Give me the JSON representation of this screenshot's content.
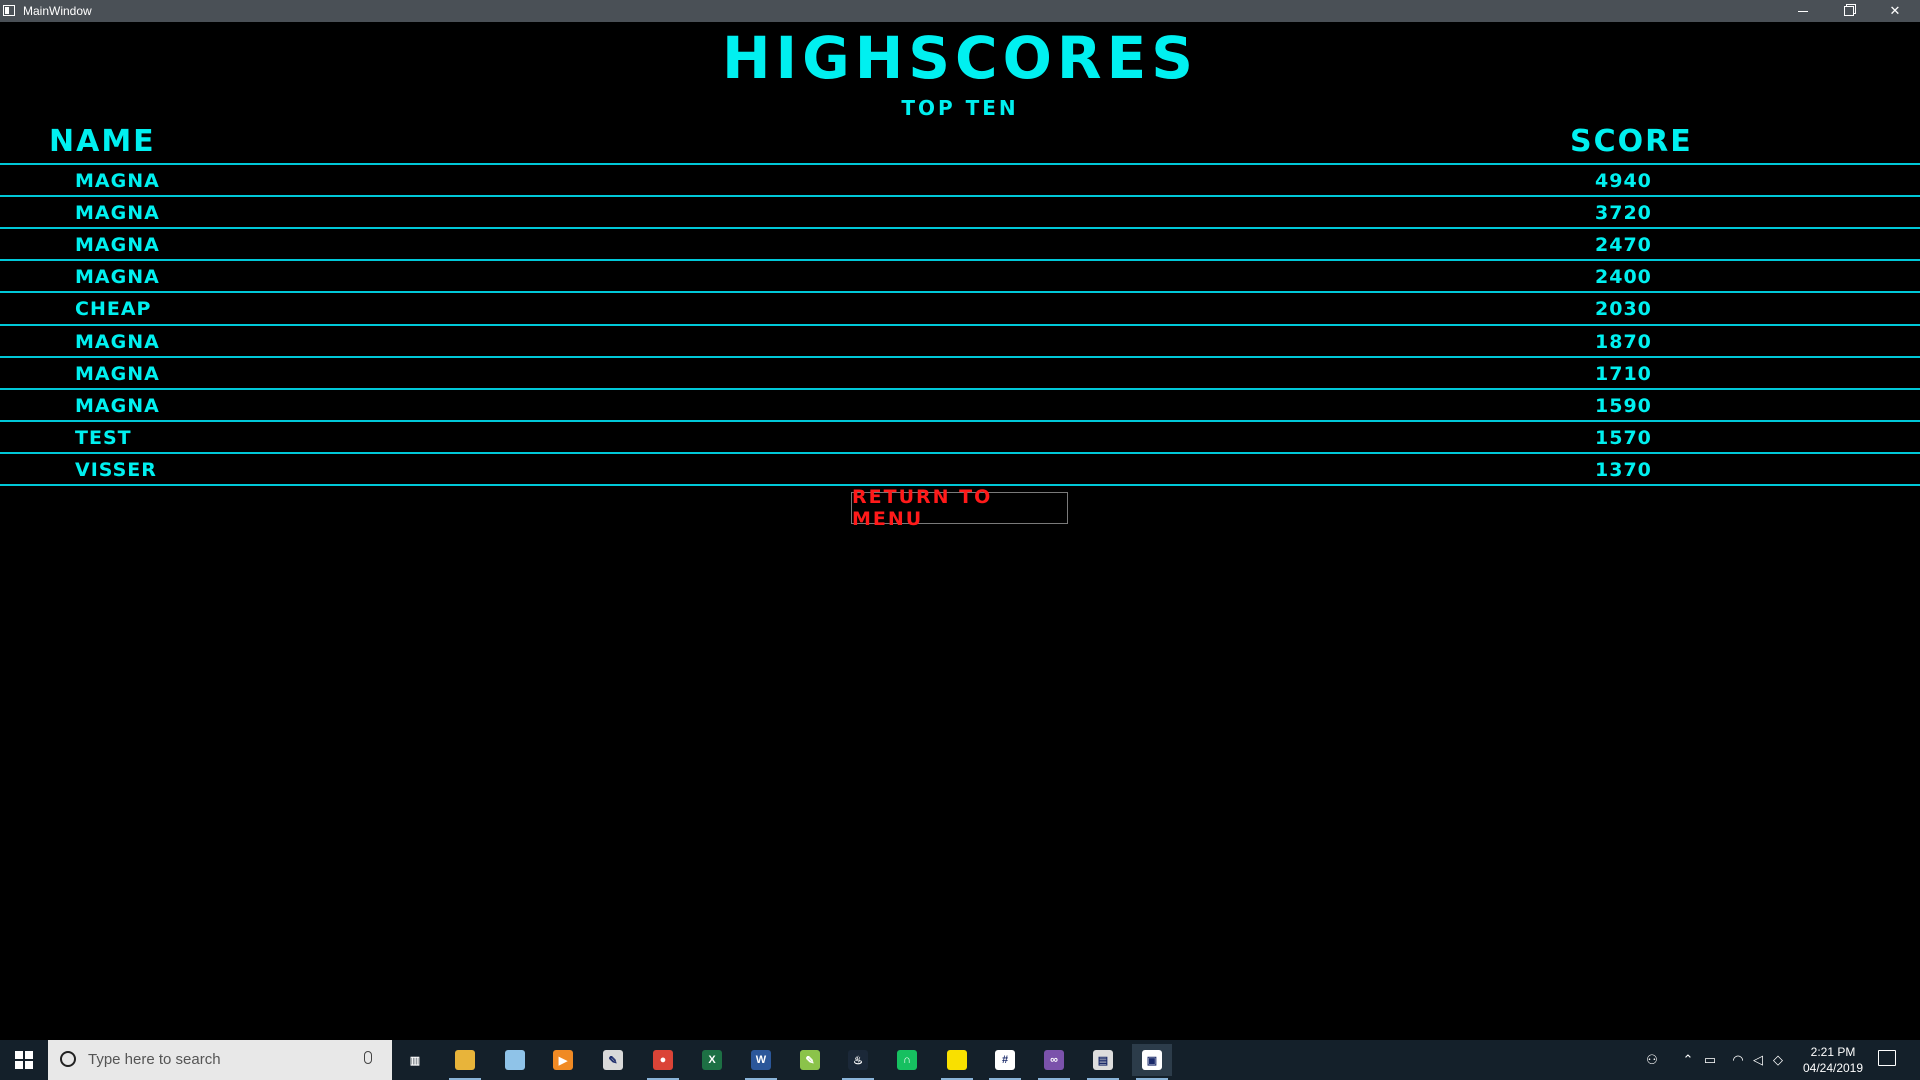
{
  "window": {
    "title": "MainWindow"
  },
  "screen": {
    "title": "HIGHSCORES",
    "subtitle": "TOP TEN",
    "columns": {
      "name": "NAME",
      "score": "SCORE"
    },
    "rows": [
      {
        "name": "MAGNA",
        "score": "4940"
      },
      {
        "name": "MAGNA",
        "score": "3720"
      },
      {
        "name": "MAGNA",
        "score": "2470"
      },
      {
        "name": "MAGNA",
        "score": "2400"
      },
      {
        "name": "CHEAP",
        "score": "2030"
      },
      {
        "name": "MAGNA",
        "score": "1870"
      },
      {
        "name": "MAGNA",
        "score": "1710"
      },
      {
        "name": "MAGNA",
        "score": "1590"
      },
      {
        "name": "TEST",
        "score": "1570"
      },
      {
        "name": "VISSER",
        "score": "1370"
      }
    ],
    "return_button": "RETURN TO MENU"
  },
  "taskbar": {
    "search_placeholder": "Type here to search",
    "apps": [
      "task-view",
      "file-explorer",
      "notepad",
      "media-player",
      "paint",
      "chrome",
      "excel",
      "word",
      "notepad-plus",
      "steam",
      "headset",
      "sticky-notes",
      "slack",
      "visual-studio",
      "movie-maker",
      "main-window"
    ],
    "clock_time": "2:21 PM",
    "clock_date": "04/24/2019"
  },
  "colors": {
    "accent": "#00f0f0",
    "button_text": "#ff1a1a",
    "background": "#000000"
  }
}
